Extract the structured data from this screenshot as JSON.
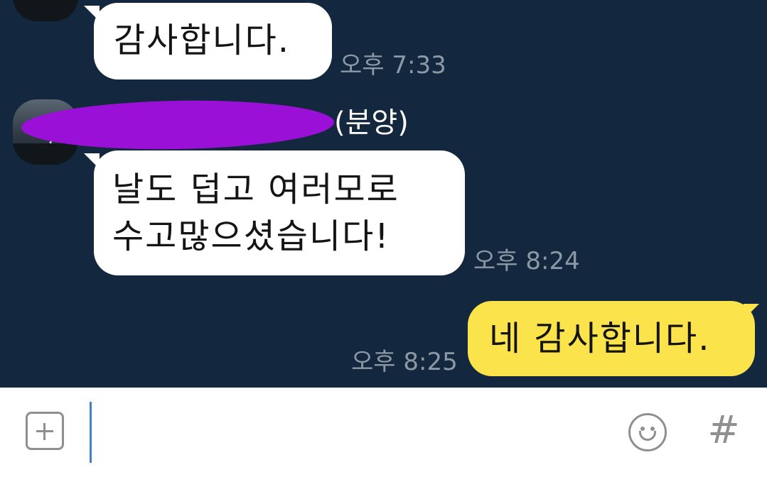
{
  "messages": [
    {
      "sender": "other",
      "text": "감사합니다.",
      "time": "오후 7:33"
    },
    {
      "sender": "other",
      "sender_name_suffix": "(분양)",
      "text": "날도 덥고 여러모로\n수고많으셨습니다!",
      "time": "오후 8:24"
    },
    {
      "sender": "me",
      "text": "네 감사합니다.",
      "time": "오후 8:25"
    }
  ],
  "input": {
    "placeholder": "",
    "value": ""
  },
  "icons": {
    "attach": "plus-square-icon",
    "emoji": "smile-icon",
    "hashtag": "hash-icon"
  },
  "hashtag_glyph": "#",
  "colors": {
    "chat_background": "#13283e",
    "my_bubble": "#fbe44b",
    "other_bubble": "#ffffff",
    "input_bar": "#ffffff",
    "redaction": "#9b10d6"
  }
}
